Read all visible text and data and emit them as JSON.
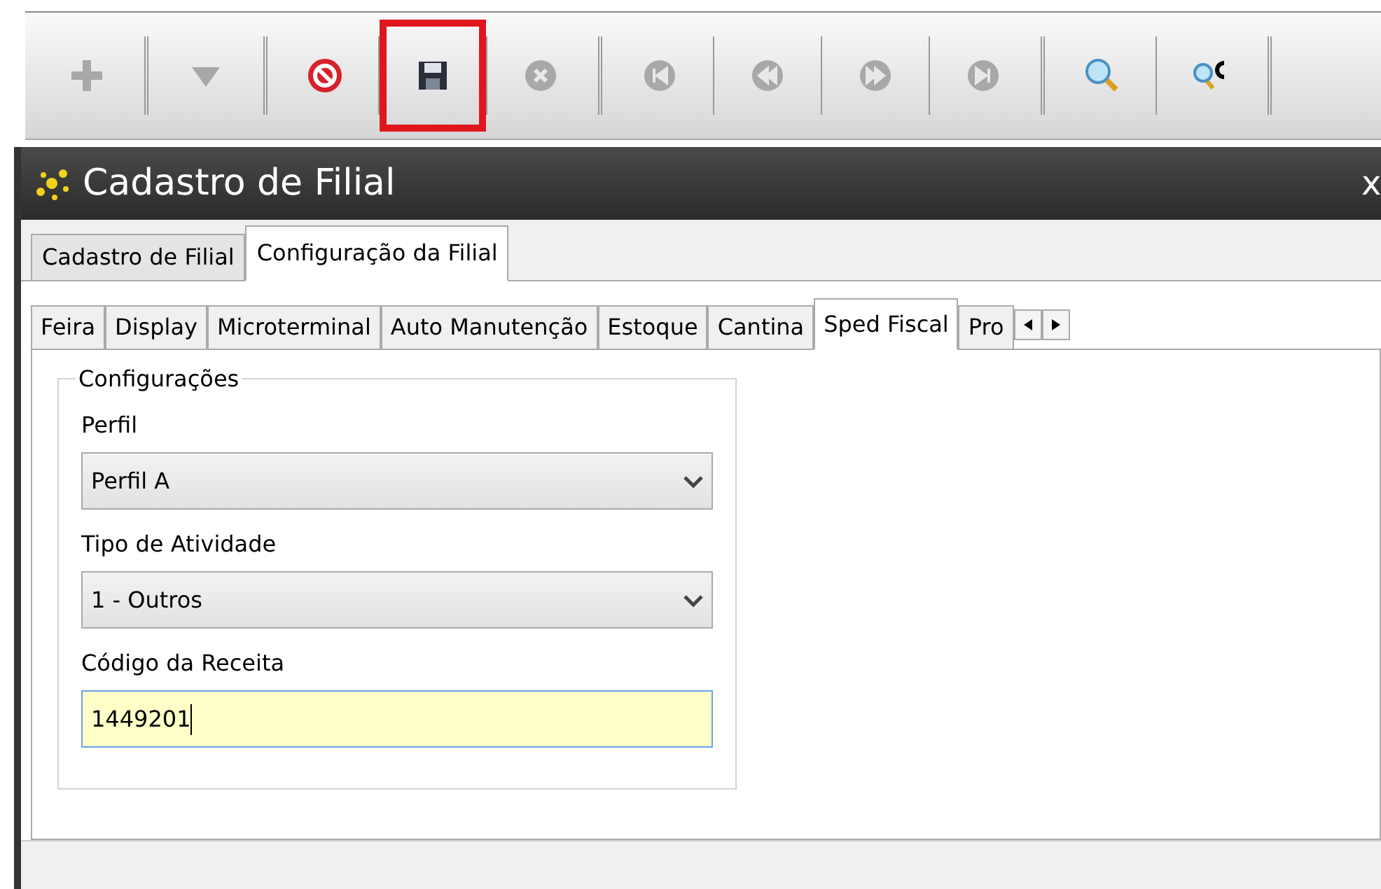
{
  "toolbar": {
    "buttons": [
      {
        "kind": "add",
        "disabled": true,
        "highlighted": false
      },
      {
        "kind": "dropdown",
        "disabled": true,
        "highlighted": false
      },
      {
        "kind": "stop",
        "disabled": false,
        "highlighted": false
      },
      {
        "kind": "save",
        "disabled": false,
        "highlighted": true
      },
      {
        "kind": "cancel",
        "disabled": true,
        "highlighted": false
      },
      {
        "kind": "first",
        "disabled": true,
        "highlighted": false
      },
      {
        "kind": "previous",
        "disabled": true,
        "highlighted": false
      },
      {
        "kind": "next",
        "disabled": true,
        "highlighted": false
      },
      {
        "kind": "last",
        "disabled": true,
        "highlighted": false
      },
      {
        "kind": "search",
        "disabled": false,
        "highlighted": false
      },
      {
        "kind": "search-code",
        "disabled": false,
        "highlighted": false
      }
    ]
  },
  "window": {
    "title": "Cadastro de Filial",
    "close": "x"
  },
  "tabs": [
    {
      "label": "Cadastro de Filial",
      "selected": false
    },
    {
      "label": "Configuração da Filial",
      "selected": true
    }
  ],
  "subtabs": [
    {
      "label": "Feira",
      "selected": false
    },
    {
      "label": "Display",
      "selected": false
    },
    {
      "label": "Microterminal",
      "selected": false
    },
    {
      "label": "Auto Manutenção",
      "selected": false
    },
    {
      "label": "Estoque",
      "selected": false
    },
    {
      "label": "Cantina",
      "selected": false
    },
    {
      "label": "Sped Fiscal",
      "selected": true
    },
    {
      "label": "Pro",
      "selected": false
    }
  ],
  "group": {
    "title": "Configurações",
    "fields": [
      {
        "kind": "select",
        "label": "Perfil",
        "value": "Perfil A"
      },
      {
        "kind": "select",
        "label": "Tipo de Atividade",
        "value": "1 - Outros"
      },
      {
        "kind": "text",
        "label": "Código da Receita",
        "value": "1449201",
        "focused": true
      }
    ]
  }
}
